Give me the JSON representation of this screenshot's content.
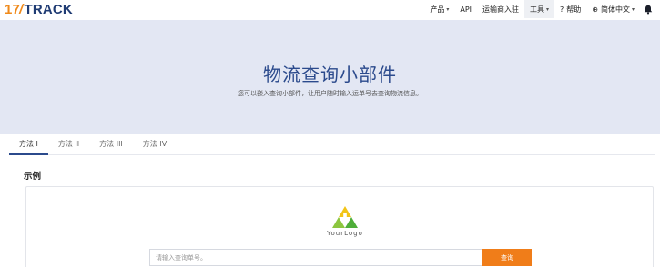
{
  "header": {
    "logo_num": "17",
    "logo_text": "TRACK",
    "nav": [
      {
        "label": "产品",
        "has_caret": true
      },
      {
        "label": "API",
        "has_caret": false
      },
      {
        "label": "运输商入驻",
        "has_caret": false
      },
      {
        "label": "工具",
        "has_caret": true
      },
      {
        "label": "帮助",
        "icon": "help-circle-icon"
      },
      {
        "label": "简体中文",
        "icon": "globe-icon",
        "has_caret": true
      }
    ],
    "bell_icon": "bell-icon"
  },
  "hero": {
    "title": "物流查询小部件",
    "subtitle": "您可以嵌入查询小部件，让用户随时输入运单号去查询物流信息。"
  },
  "tabs": [
    "方法 I",
    "方法 II",
    "方法 III",
    "方法 IV"
  ],
  "section": {
    "title": "示例",
    "brand_text": "YourLogo",
    "search_placeholder": "请输入查询单号。",
    "search_button": "查询"
  },
  "colors": {
    "accent": "#2b4a8c",
    "button": "#f07d19",
    "hero_bg": "#e3e7f3",
    "logo_orange": "#f08a1a"
  }
}
